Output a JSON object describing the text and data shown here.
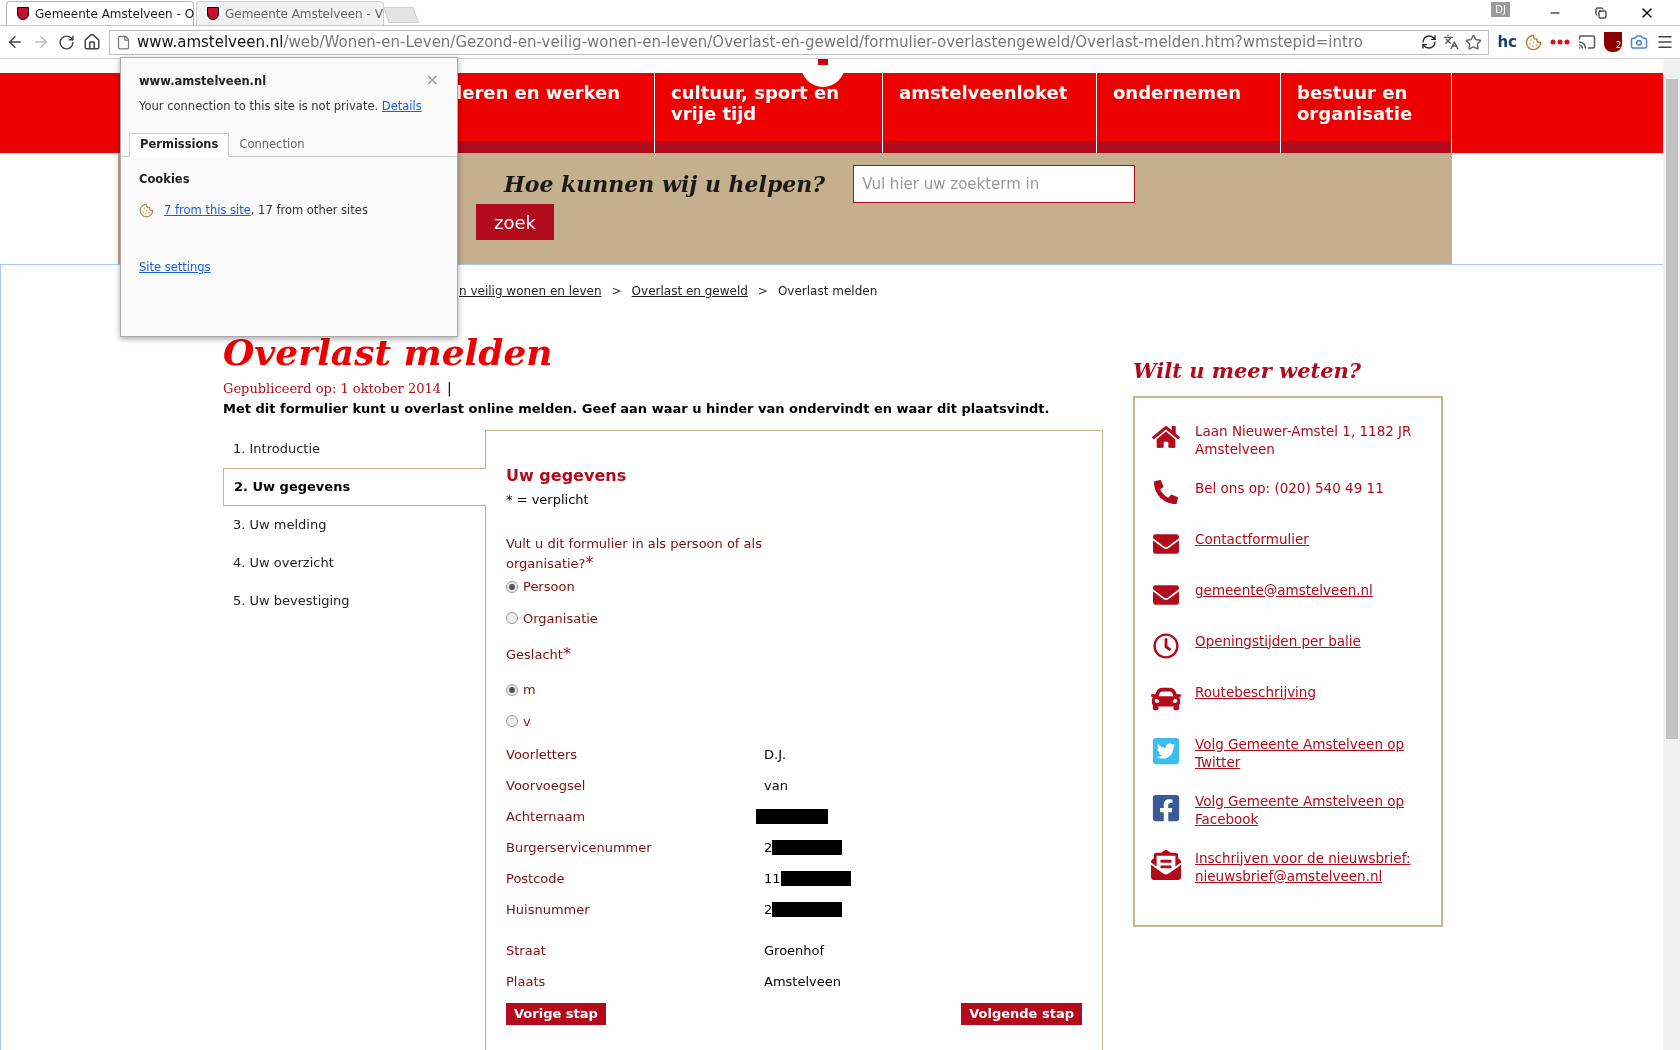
{
  "browser": {
    "tabs": [
      {
        "title": "Gemeente Amstelveen - O",
        "selected": true
      },
      {
        "title": "Gemeente Amstelveen - V",
        "selected": false
      }
    ],
    "profile": "DJ",
    "address": {
      "host": "www.amstelveen.nl",
      "path": "/web/Wonen-en-Leven/Gezond-en-veilig-wonen-en-leven/Overlast-en-geweld/formulier-overlastengeweld/Overlast-melden.htm?wmstepid=intro"
    },
    "extension_text": "hc",
    "extension_badge": "2"
  },
  "site_popup": {
    "host": "www.amstelveen.nl",
    "close": "×",
    "message": "Your connection to this site is not private.",
    "details_link": "Details",
    "tabs": [
      {
        "label": "Permissions",
        "selected": true
      },
      {
        "label": "Connection",
        "selected": false
      }
    ],
    "cookies_title": "Cookies",
    "cookies_link": "7 from this site",
    "cookies_rest": ", 17 from other sites",
    "settings_link": "Site settings"
  },
  "nav": {
    "items": [
      "leren en werken",
      "cultuur, sport en vrije tijd",
      "amstelveenloket",
      "ondernemen",
      "bestuur en organisatie"
    ]
  },
  "search": {
    "heading": "Hoe kunnen wij u helpen?",
    "placeholder": "Vul hier uw zoekterm in",
    "button": "zoek"
  },
  "breadcrumb": [
    {
      "label": "n veilig wonen en leven",
      "link": true
    },
    {
      "label": "Overlast en geweld",
      "link": true
    },
    {
      "label": "Overlast melden",
      "link": false
    }
  ],
  "breadcrumb_separator": ">",
  "page": {
    "title": "Overlast melden",
    "published": "Gepubliceerd op: 1 oktober 2014",
    "published_separator": "|",
    "intro": "Met dit formulier kunt u overlast online melden. Geef aan waar u hinder van ondervindt en waar dit plaatsvindt."
  },
  "steps": [
    {
      "label": "1. Introductie",
      "selected": false
    },
    {
      "label": "2. Uw gegevens",
      "selected": true
    },
    {
      "label": "3. Uw melding",
      "selected": false
    },
    {
      "label": "4. Uw overzicht",
      "selected": false
    },
    {
      "label": "5. Uw bevestiging",
      "selected": false
    }
  ],
  "form": {
    "title": "Uw gegevens",
    "legend": "* = verplicht",
    "questions": [
      {
        "label": "Vult u dit formulier in als persoon of als organisatie?",
        "required_mark": "*",
        "options": [
          {
            "label": "Persoon",
            "selected": true
          },
          {
            "label": "Organisatie",
            "selected": false
          }
        ]
      },
      {
        "label": "Geslacht",
        "required_mark": "*",
        "options": [
          {
            "label": "m",
            "selected": true
          },
          {
            "label": "v",
            "selected": false
          }
        ]
      }
    ],
    "fields": [
      {
        "label": "Voorletters",
        "value": "D.J.",
        "redacted": false
      },
      {
        "label": "Voorvoegsel",
        "value": "van",
        "redacted": false
      },
      {
        "label": "Achternaam",
        "redacted": true
      },
      {
        "label": "Burgerservicenummer",
        "value": "2",
        "redacted": true
      },
      {
        "label": "Postcode",
        "value": "11",
        "redacted": true
      },
      {
        "label": "Huisnummer",
        "value": "2",
        "redacted": true
      },
      {
        "label": "Straat",
        "value": "Groenhof",
        "redacted": false
      },
      {
        "label": "Plaats",
        "value": "Amstelveen",
        "redacted": false
      }
    ],
    "buttons": [
      "Vorige stap",
      "Volgende stap"
    ]
  },
  "contact": {
    "heading": "Wilt u meer weten?",
    "items": [
      {
        "text": "Laan Nieuwer-Amstel 1, 1182 JR Amstelveen",
        "kind": "text"
      },
      {
        "text": "Bel ons op: (020) 540 49 11",
        "kind": "text"
      },
      {
        "text": "Contactformulier",
        "kind": "link"
      },
      {
        "text": "gemeente@amstelveen.nl",
        "kind": "link"
      },
      {
        "text": "Openingstijden per balie",
        "kind": "link"
      },
      {
        "text": "Routebeschrijving",
        "kind": "link"
      },
      {
        "text": "Volg Gemeente Amstelveen op Twitter",
        "kind": "link"
      },
      {
        "text": "Volg Gemeente Amstelveen op Facebook",
        "kind": "link"
      },
      {
        "text": "Inschrijven voor de nieuwsbrief: nieuwsbrief@amstelveen.nl",
        "kind": "link"
      }
    ]
  }
}
